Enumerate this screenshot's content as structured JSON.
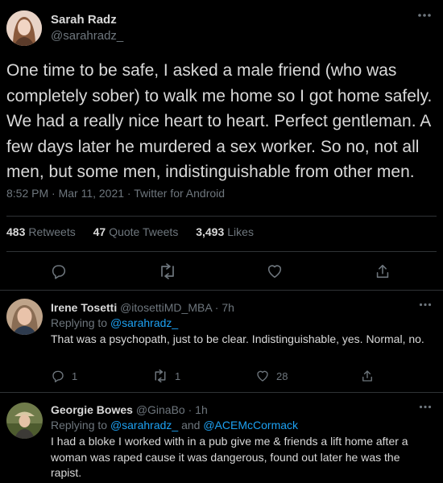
{
  "main_tweet": {
    "author_name": "Sarah Radz",
    "author_handle": "@sarahradz_",
    "text": "One time to be safe, I asked a male friend (who was completely sober) to walk me home so I got home safely. We had a really nice heart to heart. Perfect gentleman. A few days later he murdered a sex worker. So no, not all men, but some men, indistinguishable from other men.",
    "timestamp": "8:52 PM · Mar 11, 2021 · Twitter for Android",
    "retweets_count": "483",
    "retweets_label": "Retweets",
    "quotes_count": "47",
    "quotes_label": "Quote Tweets",
    "likes_count": "3,493",
    "likes_label": "Likes"
  },
  "replies": [
    {
      "name": "Irene Tosetti",
      "handle_time": "@itosettiMD_MBA · 7h",
      "replying_prefix": "Replying to ",
      "replying_to": "@sarahradz_",
      "text": "That was a psychopath, just to be clear. Indistinguishable, yes. Normal, no.",
      "reply_count": "1",
      "retweet_count": "1",
      "like_count": "28"
    },
    {
      "name": "Georgie Bowes",
      "handle_time": "@GinaBo · 1h",
      "replying_prefix": "Replying to ",
      "replying_to": "@sarahradz_",
      "replying_and": " and ",
      "replying_to_2": "@ACEMcCormack",
      "text": "I had a bloke I worked with in a pub give me & friends a lift home after a woman was raped cause it was dangerous, found out later he was the rapist."
    }
  ],
  "colors": {
    "background": "#000000",
    "text": "#D9D9D9",
    "secondary": "#6E767D",
    "link": "#1DA1F2",
    "divider": "#2F3336"
  },
  "icons": [
    "more-icon",
    "reply-icon",
    "retweet-icon",
    "like-icon",
    "share-icon"
  ]
}
